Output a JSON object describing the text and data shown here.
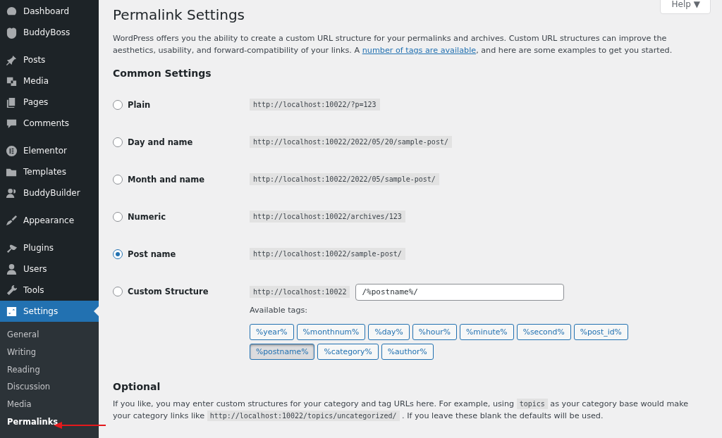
{
  "sidebar": {
    "groups": [
      [
        {
          "label": "Dashboard",
          "selected": false
        },
        {
          "label": "BuddyBoss",
          "selected": false
        }
      ],
      [
        {
          "label": "Posts",
          "selected": false
        },
        {
          "label": "Media",
          "selected": false
        },
        {
          "label": "Pages",
          "selected": false
        },
        {
          "label": "Comments",
          "selected": false
        }
      ],
      [
        {
          "label": "Elementor",
          "selected": false
        },
        {
          "label": "Templates",
          "selected": false
        },
        {
          "label": "BuddyBuilder",
          "selected": false
        }
      ],
      [
        {
          "label": "Appearance",
          "selected": false
        }
      ],
      [
        {
          "label": "Plugins",
          "selected": false
        },
        {
          "label": "Users",
          "selected": false
        },
        {
          "label": "Tools",
          "selected": false
        },
        {
          "label": "Settings",
          "selected": true
        }
      ]
    ],
    "submenu": [
      {
        "label": "General",
        "selected": false
      },
      {
        "label": "Writing",
        "selected": false
      },
      {
        "label": "Reading",
        "selected": false
      },
      {
        "label": "Discussion",
        "selected": false
      },
      {
        "label": "Media",
        "selected": false
      },
      {
        "label": "Permalinks",
        "selected": true
      }
    ]
  },
  "help_button": "Help ▼",
  "title": "Permalink Settings",
  "intro": [
    {
      "kind": "text",
      "text": "WordPress offers you the ability to create a custom URL structure for your permalinks and archives. Custom URL structures can improve the aesthetics, usability, and forward-compatibility of your links. A "
    },
    {
      "kind": "link",
      "text": "number of tags are available"
    },
    {
      "kind": "text",
      "text": ", and here are some examples to get you started."
    }
  ],
  "common_heading": "Common Settings",
  "options": [
    {
      "kind": "example",
      "label": "Plain",
      "selected": false,
      "example": "http://localhost:10022/?p=123"
    },
    {
      "kind": "example",
      "label": "Day and name",
      "selected": false,
      "example": "http://localhost:10022/2022/05/20/sample-post/"
    },
    {
      "kind": "example",
      "label": "Month and name",
      "selected": false,
      "example": "http://localhost:10022/2022/05/sample-post/"
    },
    {
      "kind": "example",
      "label": "Numeric",
      "selected": false,
      "example": "http://localhost:10022/archives/123"
    },
    {
      "kind": "example",
      "label": "Post name",
      "selected": true,
      "example": "http://localhost:10022/sample-post/"
    },
    {
      "kind": "custom",
      "label": "Custom Structure",
      "selected": false,
      "example": "http://localhost:10022",
      "value": "/%postname%/"
    }
  ],
  "available_tags_label": "Available tags:",
  "tags": [
    {
      "label": "%year%",
      "selected": false
    },
    {
      "label": "%monthnum%",
      "selected": false
    },
    {
      "label": "%day%",
      "selected": false
    },
    {
      "label": "%hour%",
      "selected": false
    },
    {
      "label": "%minute%",
      "selected": false
    },
    {
      "label": "%second%",
      "selected": false
    },
    {
      "label": "%post_id%",
      "selected": false
    },
    {
      "label": "%postname%",
      "selected": true
    },
    {
      "label": "%category%",
      "selected": false
    },
    {
      "label": "%author%",
      "selected": false
    }
  ],
  "optional_heading": "Optional",
  "optional_text": [
    {
      "kind": "text",
      "text": "If you like, you may enter custom structures for your category and tag URLs here. For example, using "
    },
    {
      "kind": "code",
      "text": "topics"
    },
    {
      "kind": "text",
      "text": " as your category base would make your category links like "
    },
    {
      "kind": "code",
      "text": "http://localhost:10022/topics/uncategorized/"
    },
    {
      "kind": "text",
      "text": " . If you leave these blank the defaults will be used."
    }
  ]
}
